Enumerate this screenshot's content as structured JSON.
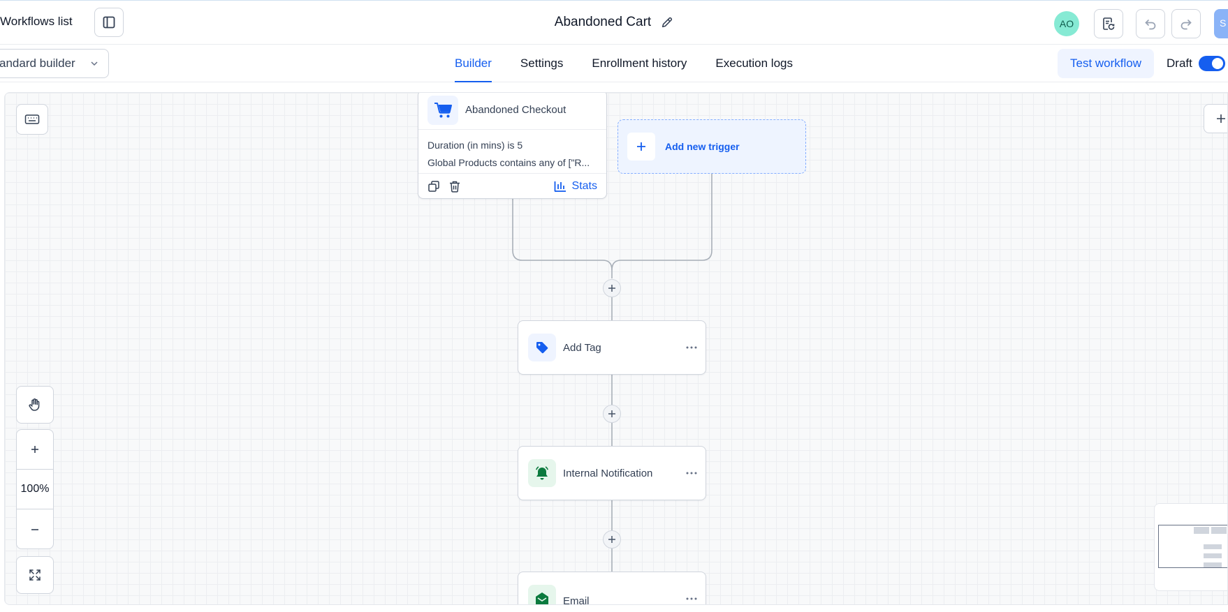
{
  "header": {
    "back_label": "Workflows list",
    "workflow_name": "Abandoned Cart",
    "avatar_initials": "AO",
    "save_label": "S"
  },
  "subbar": {
    "builder_mode": "andard builder",
    "tabs": [
      {
        "label": "Builder",
        "active": true
      },
      {
        "label": "Settings",
        "active": false
      },
      {
        "label": "Enrollment history",
        "active": false
      },
      {
        "label": "Execution logs",
        "active": false
      }
    ],
    "test_button": "Test workflow",
    "status_label": "Draft",
    "status_toggle_on": true
  },
  "canvas": {
    "zoom_level": "100%",
    "trigger": {
      "title": "Abandoned Checkout",
      "conditions": [
        "Duration (in mins) is 5",
        "Global Products contains any of [\"R..."
      ],
      "stats_label": "Stats"
    },
    "add_trigger_label": "Add new trigger",
    "actions": [
      {
        "title": "Add Tag",
        "icon": "tag-icon"
      },
      {
        "title": "Internal Notification",
        "icon": "bell-icon"
      },
      {
        "title": "Email",
        "icon": "email-icon"
      }
    ]
  },
  "colors": {
    "accent": "#155eef",
    "avatar_bg": "#86ead4",
    "action_icon_green": "#0b7a3e"
  }
}
